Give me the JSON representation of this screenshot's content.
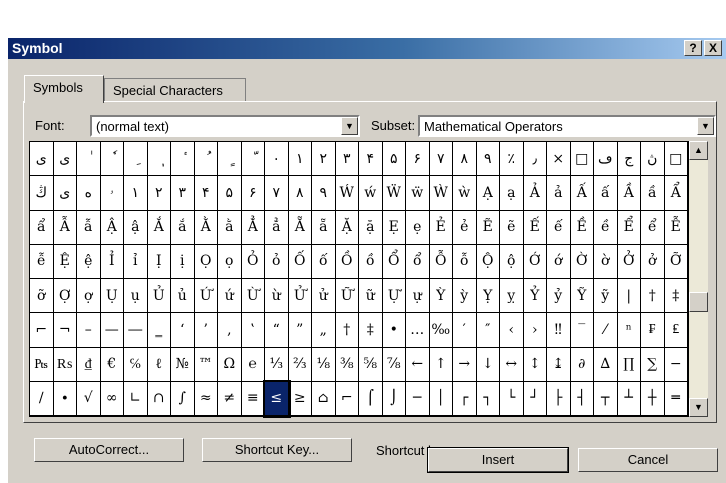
{
  "window": {
    "title": "Symbol",
    "help_btn": "?",
    "close_btn": "X"
  },
  "tabs": [
    "Symbols",
    "Special Characters"
  ],
  "font": {
    "label": "Font:",
    "value": "(normal text)"
  },
  "subset": {
    "label": "Subset:",
    "value": "Mathematical Operators"
  },
  "grid": {
    "rows": [
      [
        "ی",
        "ی",
        "ٰ",
        "ٗ",
        "ِ",
        "ٖ",
        "ٔ",
        "ُ",
        "ٍ",
        "ّ",
        "۰",
        "۱",
        "۲",
        "۳",
        "۴",
        "۵",
        "۶",
        "۷",
        "۸",
        "۹",
        "٪",
        "٫",
        "×",
        "□",
        "ڡ",
        "ج",
        "ڽ",
        "□"
      ],
      [
        "ڭ",
        "ی",
        "ە",
        "ۥ",
        "۱",
        "۲",
        "۳",
        "۴",
        "۵",
        "۶",
        "۷",
        "۸",
        "۹",
        "Ẃ",
        "ẃ",
        "Ẅ",
        "ẅ",
        "Ẁ",
        "ẁ",
        "Ạ",
        "ạ",
        "Ả",
        "ả",
        "Ấ",
        "ấ",
        "Ầ",
        "ầ",
        "Ẩ"
      ],
      [
        "ẩ",
        "Ẫ",
        "ẫ",
        "Ậ",
        "ậ",
        "Ắ",
        "ắ",
        "Ằ",
        "ằ",
        "Ẳ",
        "ẳ",
        "Ẵ",
        "ẵ",
        "Ặ",
        "ặ",
        "Ẹ",
        "ẹ",
        "Ẻ",
        "ẻ",
        "Ẽ",
        "ẽ",
        "Ế",
        "ế",
        "Ề",
        "ề",
        "Ể",
        "ể",
        "Ễ"
      ],
      [
        "ễ",
        "Ệ",
        "ệ",
        "Ỉ",
        "ỉ",
        "Ị",
        "ị",
        "Ọ",
        "ọ",
        "Ỏ",
        "ỏ",
        "Ố",
        "ố",
        "Ồ",
        "ồ",
        "Ổ",
        "ổ",
        "Ỗ",
        "ỗ",
        "Ộ",
        "ộ",
        "Ớ",
        "ớ",
        "Ờ",
        "ờ",
        "Ở",
        "ở",
        "Ỡ"
      ],
      [
        "ỡ",
        "Ợ",
        "ợ",
        "Ụ",
        "ụ",
        "Ủ",
        "ủ",
        "Ứ",
        "ứ",
        "Ừ",
        "ừ",
        "Ử",
        "ử",
        "Ữ",
        "ữ",
        "Ự",
        "ự",
        "Ỳ",
        "ỳ",
        "Ỵ",
        "ỵ",
        "Ỷ",
        "ỷ",
        "Ỹ",
        "ỹ",
        "|",
        "†",
        "‡"
      ],
      [
        "⌐",
        "¬",
        "–",
        "—",
        "―",
        "‗",
        "‘",
        "’",
        "‚",
        "‛",
        "“",
        "”",
        "„",
        "†",
        "‡",
        "•",
        "…",
        "‰",
        "′",
        "″",
        "‹",
        "›",
        "‼",
        "‾",
        "⁄",
        "ⁿ",
        "₣",
        "₤"
      ],
      [
        "₧",
        "₨",
        "₫",
        "€",
        "℅",
        "ℓ",
        "№",
        "™",
        "Ω",
        "℮",
        "⅓",
        "⅔",
        "⅛",
        "⅜",
        "⅝",
        "⅞",
        "←",
        "↑",
        "→",
        "↓",
        "↔",
        "↕",
        "↨",
        "∂",
        "∆",
        "∏",
        "∑",
        "−"
      ],
      [
        "∕",
        "∙",
        "√",
        "∞",
        "∟",
        "∩",
        "∫",
        "≈",
        "≠",
        "≡",
        "≤",
        "≥",
        "⌂",
        "⌐",
        "⌠",
        "⌡",
        "─",
        "│",
        "┌",
        "┐",
        "└",
        "┘",
        "├",
        "┤",
        "┬",
        "┴",
        "┼",
        "═"
      ]
    ],
    "selected": "≤"
  },
  "buttons": {
    "autocorrect": "AutoCorrect...",
    "shortcut_key": "Shortcut Key...",
    "shortcut_label": "Shortcut key:",
    "insert": "Insert",
    "cancel": "Cancel"
  }
}
